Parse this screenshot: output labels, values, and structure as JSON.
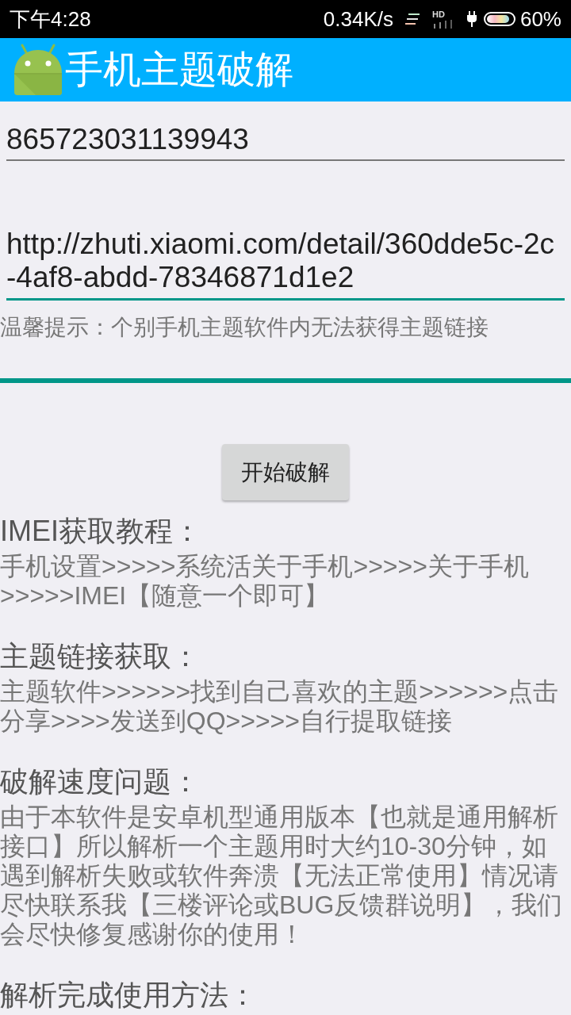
{
  "status_bar": {
    "time": "下午4:28",
    "network_speed": "0.34K/s",
    "hd_label": "HD",
    "battery_percent": "60%"
  },
  "app_bar": {
    "title": "手机主题破解"
  },
  "fields": [
    {
      "value": "865723031139943",
      "focused": false
    },
    {
      "value": "http://zhuti.xiaomi.com/detail/360dde5c-2c-4af8-abdd-78346871d1e2",
      "focused": true
    }
  ],
  "hint": "温馨提示：个别手机主题软件内无法获得主题链接",
  "start_button": {
    "label": "开始破解"
  },
  "sections": [
    {
      "heading": "IMEI获取教程：",
      "body": "手机设置>>>>>系统活关于手机>>>>>关于手机>>>>>IMEI【随意一个即可】"
    },
    {
      "heading": "主题链接获取：",
      "body": "主题软件>>>>>>找到自己喜欢的主题>>>>>>点击分享>>>>发送到QQ>>>>>自行提取链接"
    },
    {
      "heading": "破解速度问题：",
      "body": "由于本软件是安卓机型通用版本【也就是通用解析接口】所以解析一个主题用时大约10-30分钟，如遇到解析失败或软件奔溃【无法正常使用】情况请尽快联系我【三楼评论或BUG反馈群说明】，我们会尽快修复感谢你的使用！"
    },
    {
      "heading": "解析完成使用方法："
    }
  ]
}
